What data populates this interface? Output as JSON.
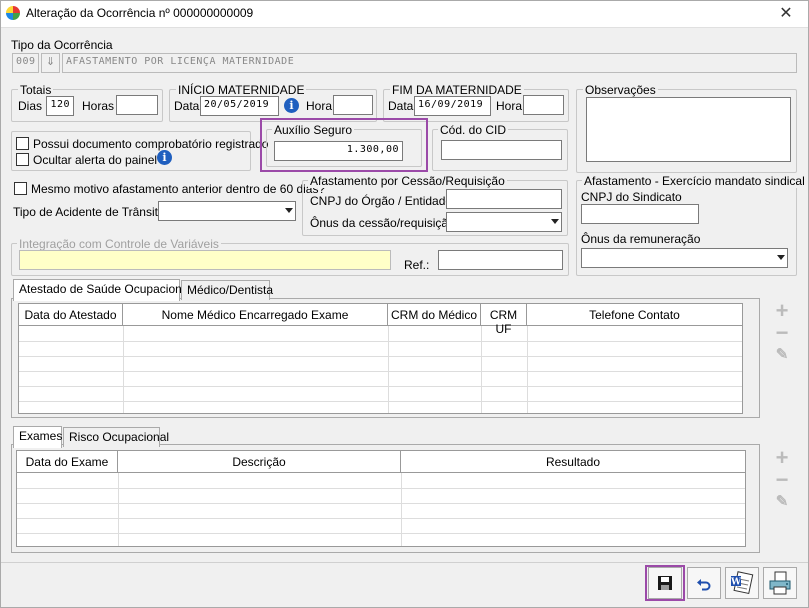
{
  "window": {
    "title": "Alteração da Ocorrência nº 000000000009",
    "close_glyph": "✕"
  },
  "tipo": {
    "label": "Tipo da Ocorrência",
    "code": "009",
    "lookup_glyph": "⇓",
    "description": "AFASTAMENTO POR LICENÇA MATERNIDADE"
  },
  "totais": {
    "title": "Totais",
    "dias_label": "Dias",
    "dias_value": "120",
    "horas_label": "Horas",
    "horas_value": ""
  },
  "inicio": {
    "title": "INÍCIO MATERNIDADE",
    "data_label": "Data",
    "data_value": "20/05/2019",
    "hora_label": "Hora",
    "hora_value": "",
    "info_glyph": "i"
  },
  "fim": {
    "title": "FIM DA MATERNIDADE",
    "data_label": "Data",
    "data_value": "16/09/2019",
    "hora_label": "Hora",
    "hora_value": ""
  },
  "observacoes": {
    "title": "Observações",
    "value": ""
  },
  "checks": {
    "possui_doc": "Possui documento comprobatório registrado",
    "ocultar_alerta": "Ocultar alerta do painel",
    "mesmo_motivo": "Mesmo motivo afastamento anterior dentro de 60 dias?",
    "info_glyph": "i"
  },
  "auxilio": {
    "title": "Auxílio Seguro",
    "value": "1.300,00"
  },
  "cid": {
    "title": "Cód. do CID",
    "value": ""
  },
  "acidente": {
    "label": "Tipo de Acidente de Trânsito:",
    "value": ""
  },
  "cessao": {
    "title": "Afastamento por Cessão/Requisição",
    "cnpj_label": "CNPJ do Órgão / Entidade:",
    "cnpj_value": "",
    "onus_label": "Ônus da cessão/requisição:",
    "onus_value": ""
  },
  "sindical": {
    "title": "Afastamento - Exercício mandato sindical",
    "cnpj_label": "CNPJ do Sindicato",
    "cnpj_value": "",
    "onus_label": "Ônus da remuneração",
    "onus_value": ""
  },
  "integracao": {
    "title": "Integração com Controle de Variáveis",
    "value": "",
    "ref_label": "Ref.:",
    "ref_value": ""
  },
  "tabs1": [
    "Atestado de Saúde Ocupacional",
    "Médico/Dentista"
  ],
  "grid1": {
    "columns": [
      "Data do Atestado",
      "Nome Médico Encarregado Exame",
      "CRM do Médico",
      "CRM UF",
      "Telefone Contato"
    ]
  },
  "tabs2": [
    "Exames",
    "Risco Ocupacional"
  ],
  "grid2": {
    "columns": [
      "Data do Exame",
      "Descrição",
      "Resultado"
    ]
  },
  "side_buttons": {
    "add": "+",
    "remove": "−",
    "edit": "✎"
  },
  "colors": {
    "highlight": "#9b4aa8",
    "integration_field": "#ffffc8",
    "info": "#1f5fbf"
  }
}
